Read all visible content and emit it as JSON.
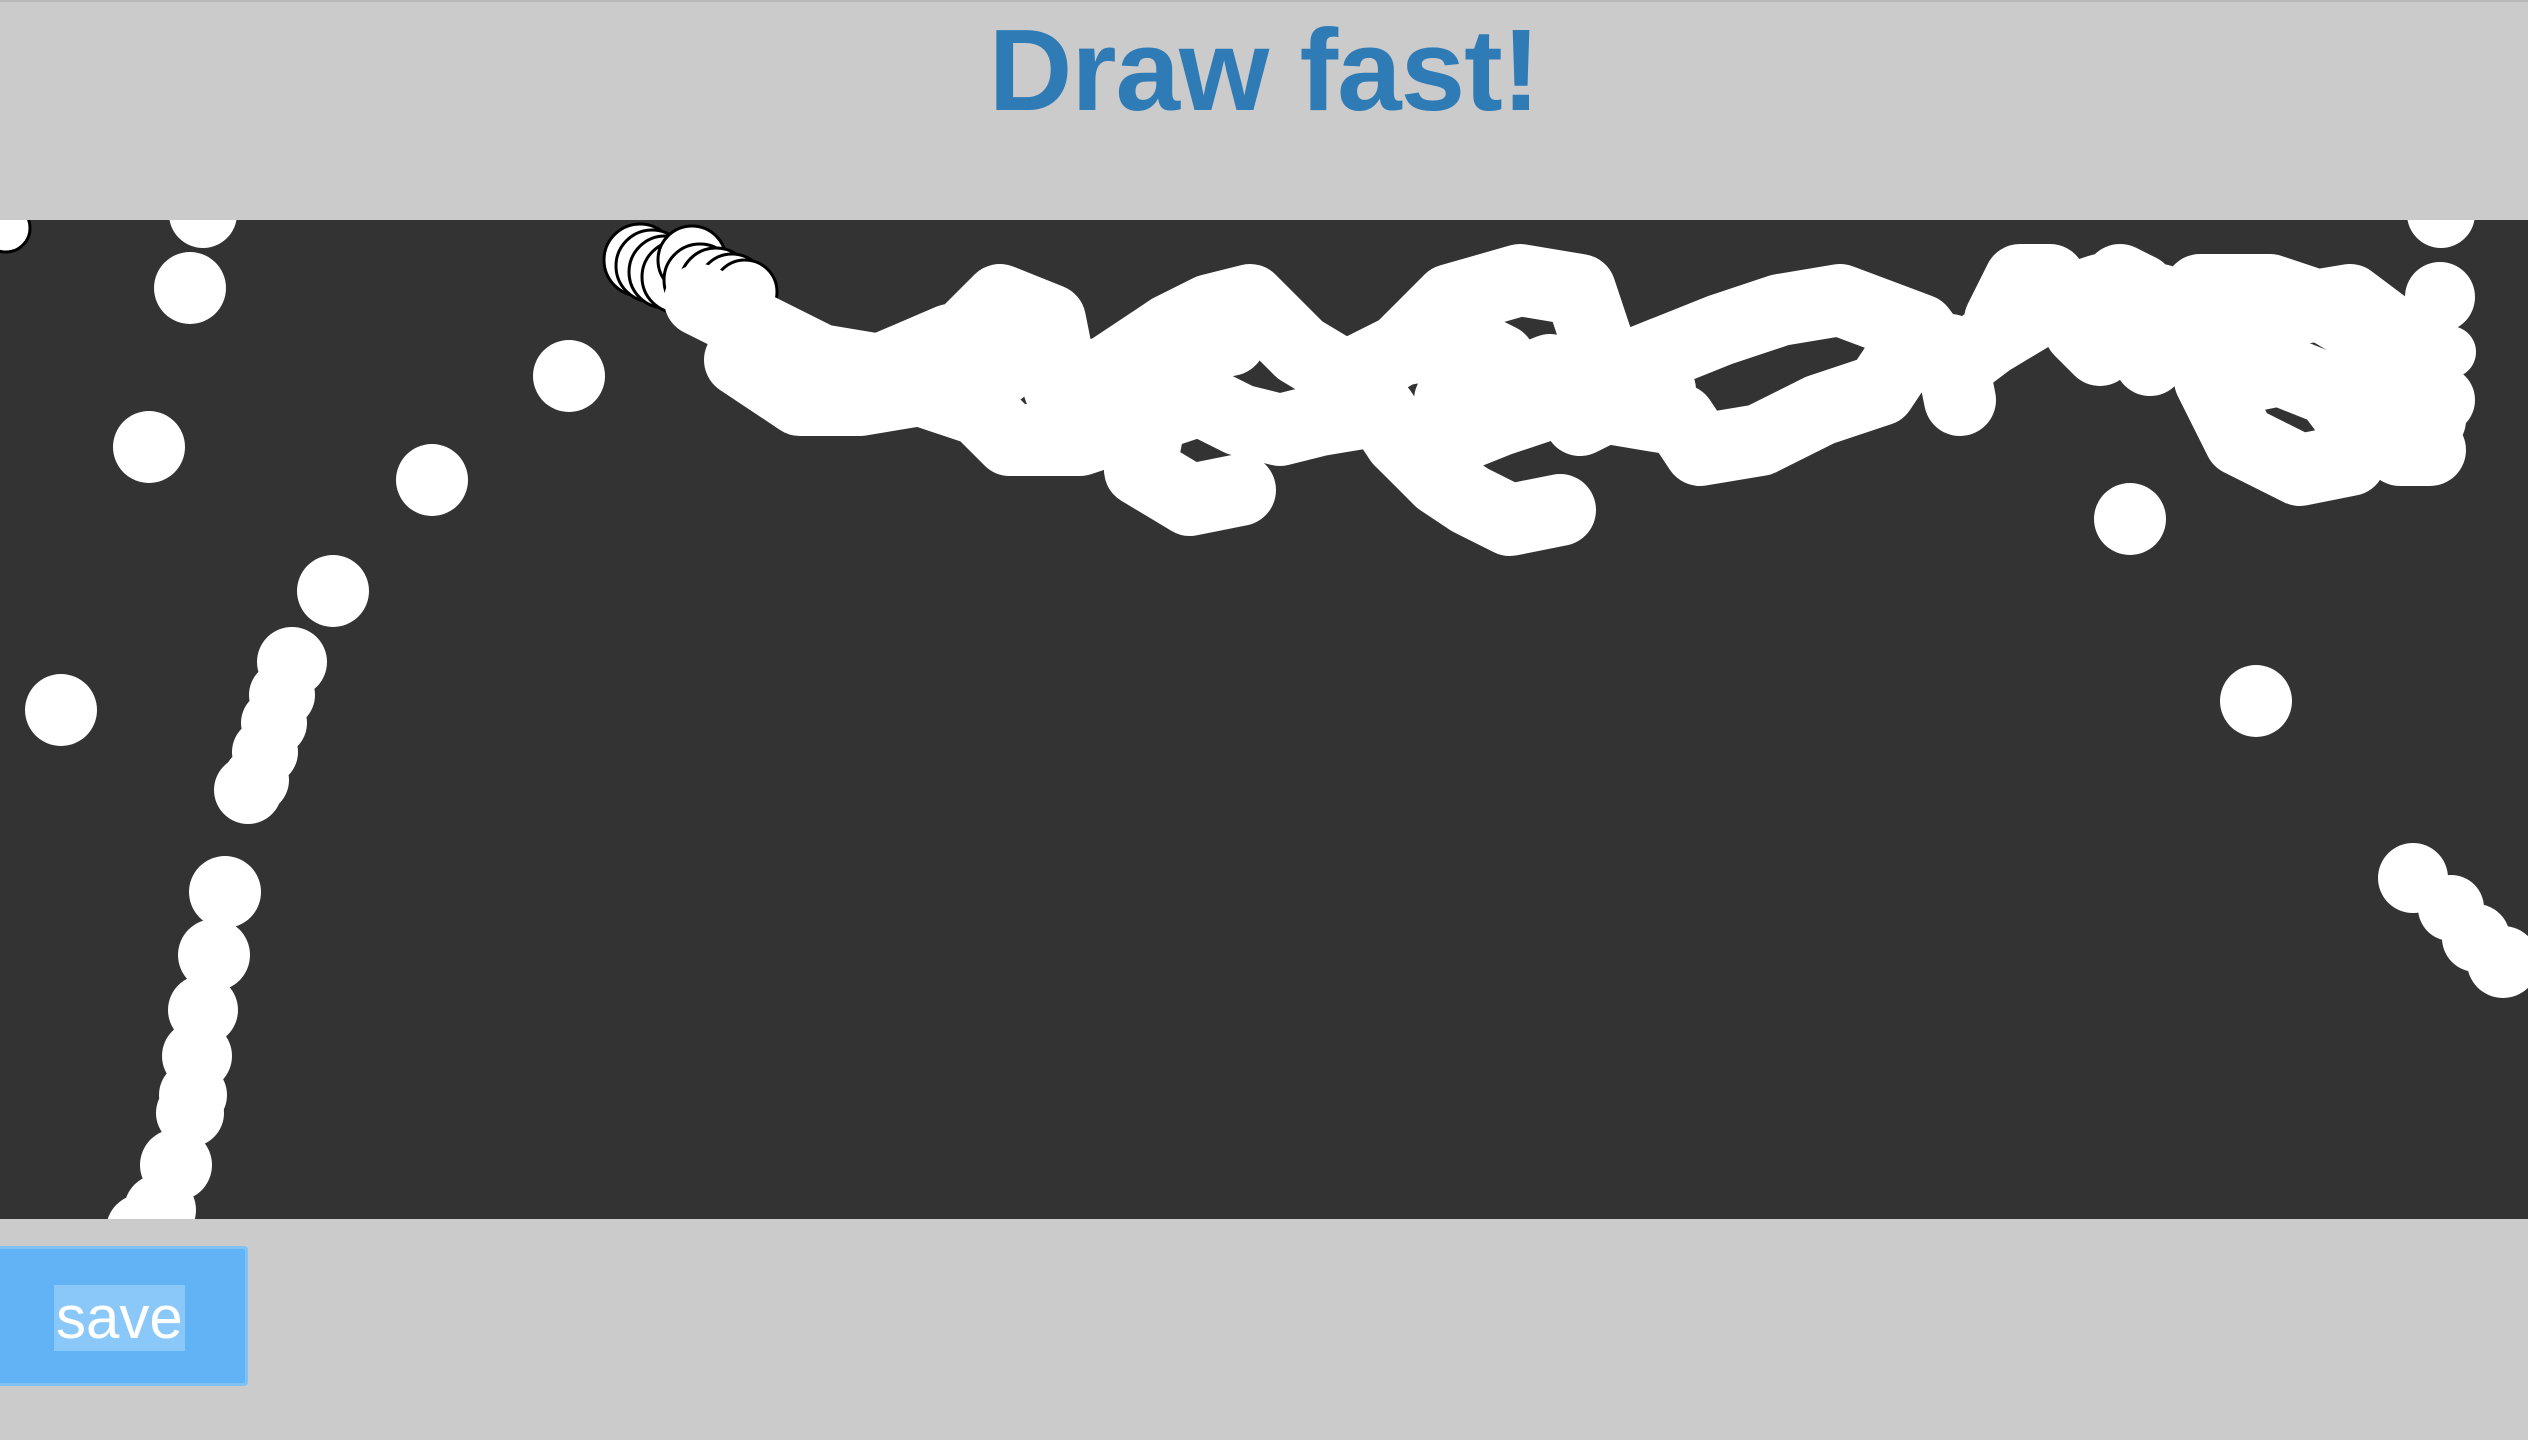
{
  "header": {
    "title": "Draw fast!"
  },
  "toolbar": {
    "save_label": "save"
  },
  "colors": {
    "title": "#2f7bb6",
    "background": "#cbcbcb",
    "canvas": "#333333",
    "stroke": "#ffffff",
    "save_button": "#62b3f5"
  }
}
